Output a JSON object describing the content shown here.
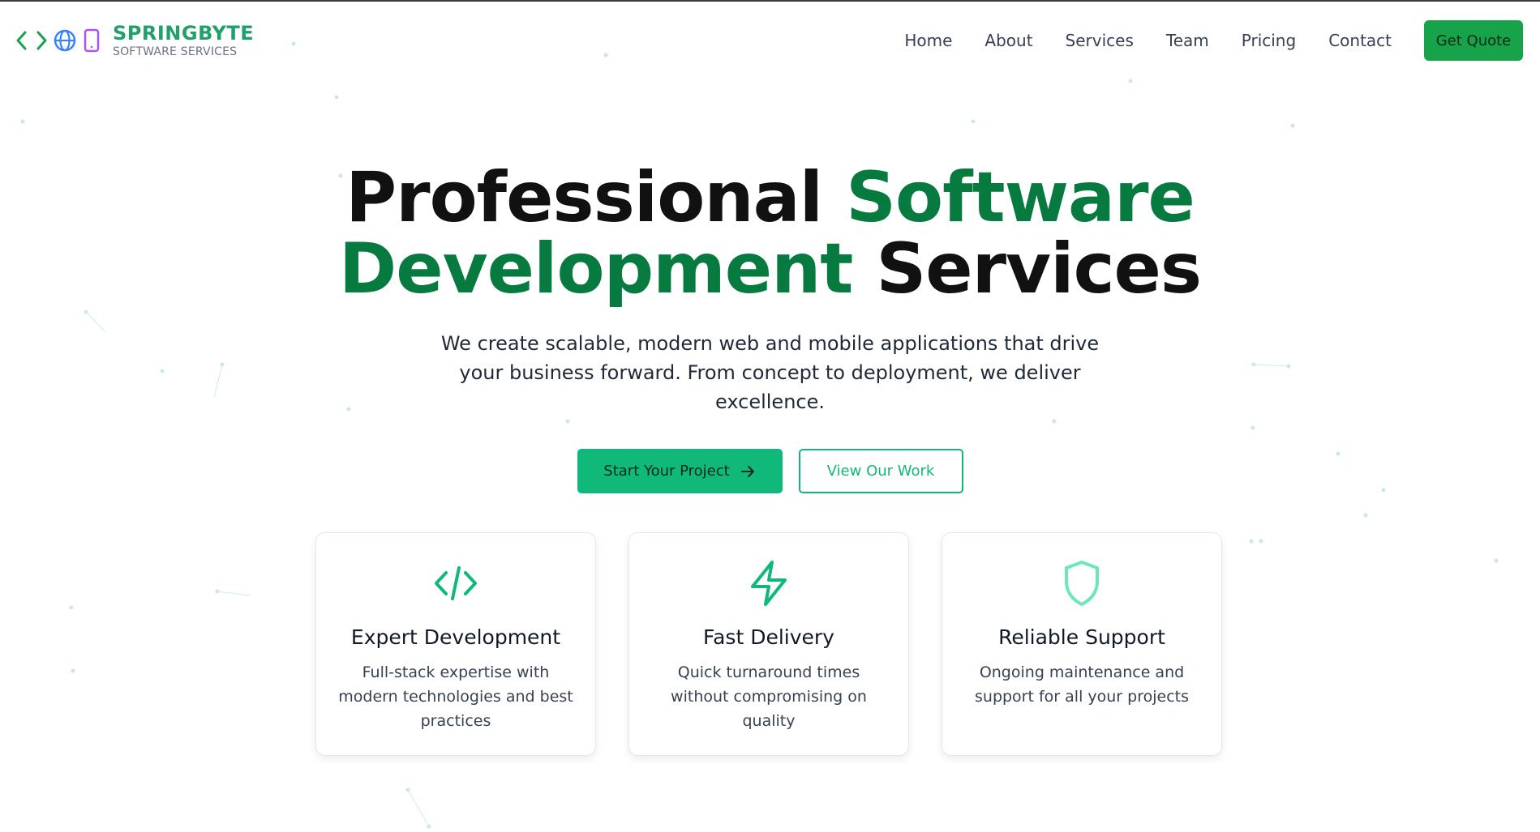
{
  "brand": {
    "name": "SPRINGBYTE",
    "tagline": "SOFTWARE SERVICES",
    "icons": [
      "code-brackets-icon",
      "globe-icon",
      "mobile-icon"
    ]
  },
  "nav": {
    "links": [
      "Home",
      "About",
      "Services",
      "Team",
      "Pricing",
      "Contact"
    ],
    "cta_label": "Get Quote"
  },
  "hero": {
    "title_part1": "Professional",
    "title_accent": "Software Development",
    "title_part2": "Services",
    "subtitle": "We create scalable, modern web and mobile applications that drive your business forward. From concept to deployment, we deliver excellence.",
    "primary_button": "Start Your Project",
    "secondary_button": "View Our Work"
  },
  "features": [
    {
      "icon": "code-icon",
      "title": "Expert Development",
      "description": "Full-stack expertise with modern technologies and best practices"
    },
    {
      "icon": "lightning-icon",
      "title": "Fast Delivery",
      "description": "Quick turnaround times without compromising on quality"
    },
    {
      "icon": "shield-icon",
      "title": "Reliable Support",
      "description": "Ongoing maintenance and support for all your projects"
    }
  ],
  "colors": {
    "brand_green": "#22a06b",
    "accent_green": "#067a3f",
    "primary_button": "#10b97a",
    "quote_button": "#16a34a"
  }
}
